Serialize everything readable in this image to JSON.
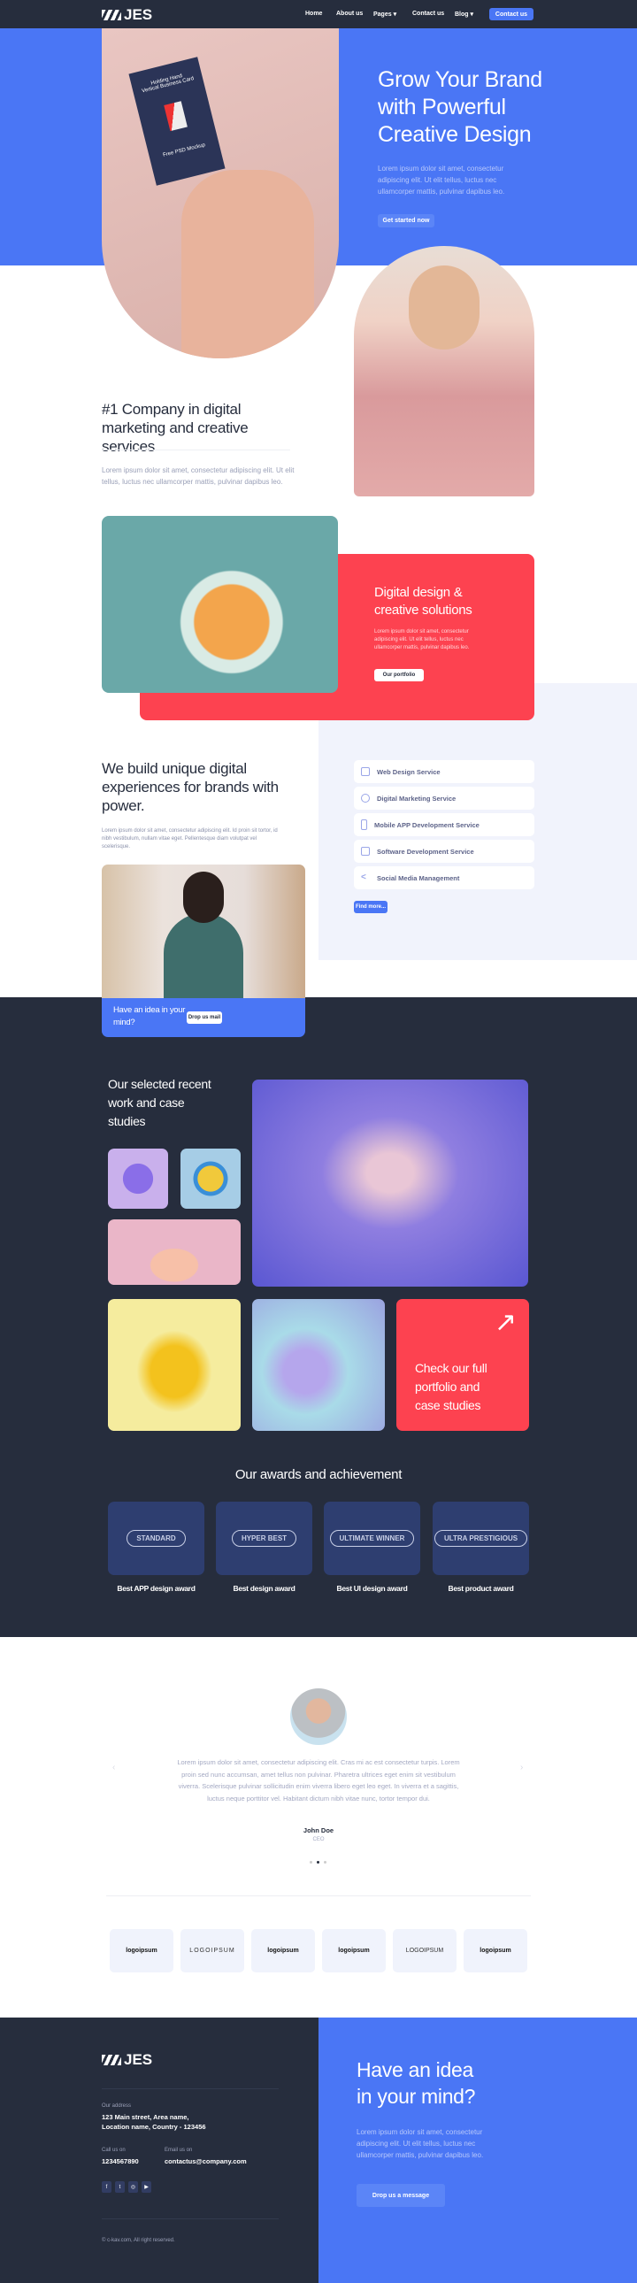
{
  "brand": "JES",
  "nav": {
    "items": [
      "Home",
      "About us",
      "Pages",
      "Contact us",
      "Blog"
    ],
    "cta": "Contact us"
  },
  "hero": {
    "title": "Grow Your Brand with Powerful Creative Design",
    "text": "Lorem ipsum dolor sit amet, consectetur adipiscing elit. Ut elit tellus, luctus nec ullamcorper mattis, pulvinar dapibus leo.",
    "button": "Get started now",
    "card_lines": [
      "Holding Hand",
      "Vertical Business Card",
      "Free PSD Mockup"
    ]
  },
  "about": {
    "title": "#1 Company in digital marketing and creative services",
    "text": "Lorem ipsum dolor sit amet, consectetur adipiscing elit. Ut elit tellus, luctus nec ullamcorper mattis, pulvinar dapibus leo."
  },
  "digital": {
    "title": "Digital design & creative solutions",
    "text": "Lorem ipsum dolor sit amet, consectetur adipiscing elit. Ut elit tellus, luctus nec ullamcorper mattis, pulvinar dapibus leo.",
    "button": "Our portfolio"
  },
  "build": {
    "title": "We build unique digital experiences for brands with power.",
    "text": "Lorem ipsum dolor sit amet, consectetur adipiscing elit. Id proin sit tortor, id nibh vestibulum, nullam vitae eget. Pellentesque diam volutpat vel scelerisque.",
    "idea": "Have an idea in your mind?",
    "idea_button": "Drop us mail"
  },
  "services": {
    "items": [
      {
        "label": "Web Design Service",
        "icon": "code-window-icon"
      },
      {
        "label": "Digital Marketing Service",
        "icon": "virus-network-icon"
      },
      {
        "label": "Mobile APP Development Service",
        "icon": "mobile-icon"
      },
      {
        "label": "Software Development Service",
        "icon": "software-icon"
      },
      {
        "label": "Social Media Management",
        "icon": "share-icon"
      }
    ],
    "button": "Find more..."
  },
  "portfolio": {
    "title": "Our selected recent work and case studies",
    "cta": "Check our full portfolio and case studies"
  },
  "awards": {
    "title": "Our awards and achievement",
    "items": [
      {
        "label": "Best APP design award",
        "badge": "STANDARD"
      },
      {
        "label": "Best design award",
        "badge": "HYPER BEST"
      },
      {
        "label": "Best UI design award",
        "badge": "ULTIMATE WINNER"
      },
      {
        "label": "Best product award",
        "badge": "ULTRA PRESTIGIOUS"
      }
    ]
  },
  "testimonial": {
    "text": "Lorem ipsum dolor sit amet, consectetur adipiscing elit. Cras mi ac est consectetur turpis. Lorem proin sed nunc accumsan, amet tellus non pulvinar. Pharetra ultrices eget enim sit vestibulum viverra. Scelerisque pulvinar sollicitudin enim viverra libero eget leo eget. In viverra et a sagittis, luctus neque porttitor vel. Habitant dictum nibh vitae nunc, tortor tempor dui.",
    "name": "John Doe",
    "role": "CEO"
  },
  "logos": [
    "logoipsum",
    "LOGOIPSUM",
    "logoipsum",
    "logoipsum",
    "LOGOIPSUM",
    "logoipsum"
  ],
  "footer": {
    "address_label": "Our address",
    "address": "123 Main street, Area name, Location name, Country - 123456",
    "call_label": "Call us on",
    "phone": "1234567890",
    "email_label": "Email us on",
    "email": "contactus@company.com",
    "copyright": "© c-kav.com, All right reserved.",
    "cta_title": "Have an idea in your mind?",
    "cta_text": "Lorem ipsum dolor sit amet, consectetur adipiscing elit. Ut elit tellus, luctus nec ullamcorper mattis, pulvinar dapibus leo.",
    "cta_button": "Drop us a message"
  },
  "colors": {
    "blue": "#4a76f5",
    "dark": "#262d3d",
    "red": "#fd4250",
    "light": "#f1f3fc"
  }
}
